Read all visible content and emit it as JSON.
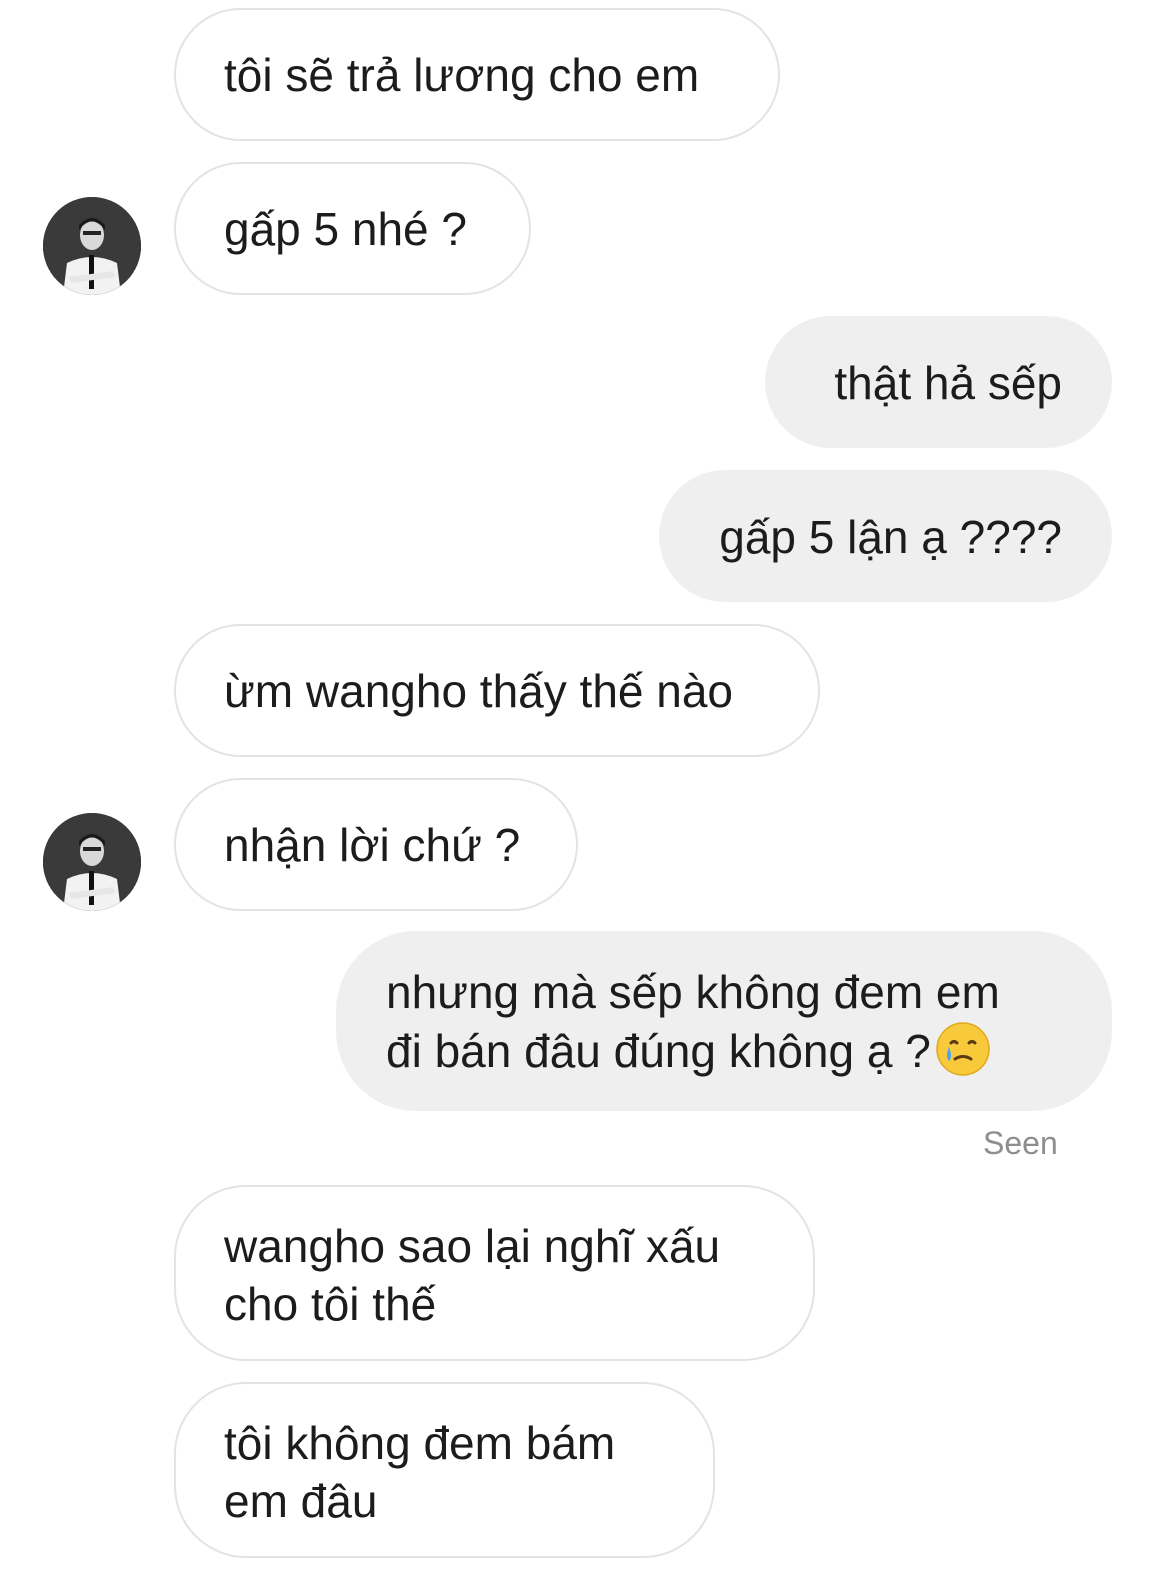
{
  "conversation": {
    "messages": [
      {
        "from": "them",
        "lines": [
          "tôi sẽ trả lương cho em"
        ]
      },
      {
        "from": "them",
        "lines": [
          "gấp 5 nhé ?"
        ],
        "avatar": "profile-avatar"
      },
      {
        "from": "me",
        "lines": [
          "thật hả sếp"
        ]
      },
      {
        "from": "me",
        "lines": [
          "gấp 5 lận ạ ????"
        ]
      },
      {
        "from": "them",
        "lines": [
          "ừm wangho thấy thế nào"
        ]
      },
      {
        "from": "them",
        "lines": [
          "nhận lời chứ ?"
        ],
        "avatar": "profile-avatar"
      },
      {
        "from": "me",
        "lines": [
          "nhưng mà sếp không đem em",
          "đi bán đâu đúng không ạ ?"
        ],
        "emoji": "crying-smile-emoji"
      },
      {
        "from": "them",
        "lines": [
          "wangho sao lại nghĩ xấu",
          "cho tôi thế"
        ]
      },
      {
        "from": "them",
        "lines": [
          "tôi không đem bám",
          "em đâu"
        ]
      }
    ],
    "seen_label": "Seen"
  },
  "colors": {
    "sent_bubble": "#efefef",
    "received_border": "#e3e3e3",
    "text": "#1c1c1c",
    "seen_text": "#8e8e8e"
  }
}
